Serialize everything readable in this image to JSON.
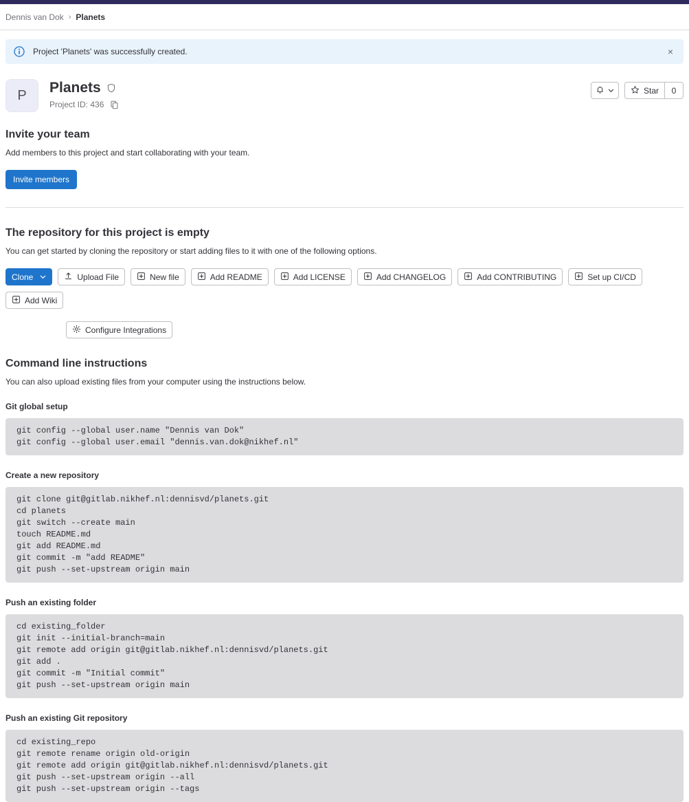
{
  "breadcrumb": {
    "owner": "Dennis van Dok",
    "separator": "›",
    "current": "Planets"
  },
  "alert": {
    "icon": "information-icon",
    "message": "Project 'Planets' was successfully created.",
    "close_label": "×",
    "background": "#e9f3fc"
  },
  "project": {
    "avatar_letter": "P",
    "name": "Planets",
    "visibility_icon": "shield-icon",
    "project_id_label": "Project ID: 436",
    "copy_icon": "copy-icon"
  },
  "header_actions": {
    "notifications_icon": "bell-icon",
    "notifications_chevron": "chevron-down-icon",
    "star_icon": "star-icon",
    "star_label": "Star",
    "star_count": "0"
  },
  "invite": {
    "title": "Invite your team",
    "description": "Add members to this project and start collaborating with your team.",
    "button_label": "Invite members",
    "button_color": "#1f75cb"
  },
  "empty_repo": {
    "title": "The repository for this project is empty",
    "description": "You can get started by cloning the repository or start adding files to it with one of the following options.",
    "actions": [
      {
        "label": "Clone",
        "icon": "chevron-down-icon",
        "primary": true
      },
      {
        "label": "Upload File",
        "icon": "upload-icon",
        "primary": false
      },
      {
        "label": "New file",
        "icon": "plus-square-icon",
        "primary": false
      },
      {
        "label": "Add README",
        "icon": "plus-square-icon",
        "primary": false
      },
      {
        "label": "Add LICENSE",
        "icon": "plus-square-icon",
        "primary": false
      },
      {
        "label": "Add CHANGELOG",
        "icon": "plus-square-icon",
        "primary": false
      },
      {
        "label": "Add CONTRIBUTING",
        "icon": "plus-square-icon",
        "primary": false
      },
      {
        "label": "Set up CI/CD",
        "icon": "plus-square-icon",
        "primary": false
      },
      {
        "label": "Add Wiki",
        "icon": "plus-square-icon",
        "primary": false
      },
      {
        "label": "Configure Integrations",
        "icon": "gear-icon",
        "primary": false
      }
    ]
  },
  "cli": {
    "title": "Command line instructions",
    "description": "You can also upload existing files from your computer using the instructions below.",
    "blocks": [
      {
        "label": "Git global setup",
        "code": "git config --global user.name \"Dennis van Dok\"\ngit config --global user.email \"dennis.van.dok@nikhef.nl\""
      },
      {
        "label": "Create a new repository",
        "code": "git clone git@gitlab.nikhef.nl:dennisvd/planets.git\ncd planets\ngit switch --create main\ntouch README.md\ngit add README.md\ngit commit -m \"add README\"\ngit push --set-upstream origin main"
      },
      {
        "label": "Push an existing folder",
        "code": "cd existing_folder\ngit init --initial-branch=main\ngit remote add origin git@gitlab.nikhef.nl:dennisvd/planets.git\ngit add .\ngit commit -m \"Initial commit\"\ngit push --set-upstream origin main"
      },
      {
        "label": "Push an existing Git repository",
        "code": "cd existing_repo\ngit remote rename origin old-origin\ngit remote add origin git@gitlab.nikhef.nl:dennisvd/planets.git\ngit push --set-upstream origin --all\ngit push --set-upstream origin --tags"
      }
    ]
  }
}
